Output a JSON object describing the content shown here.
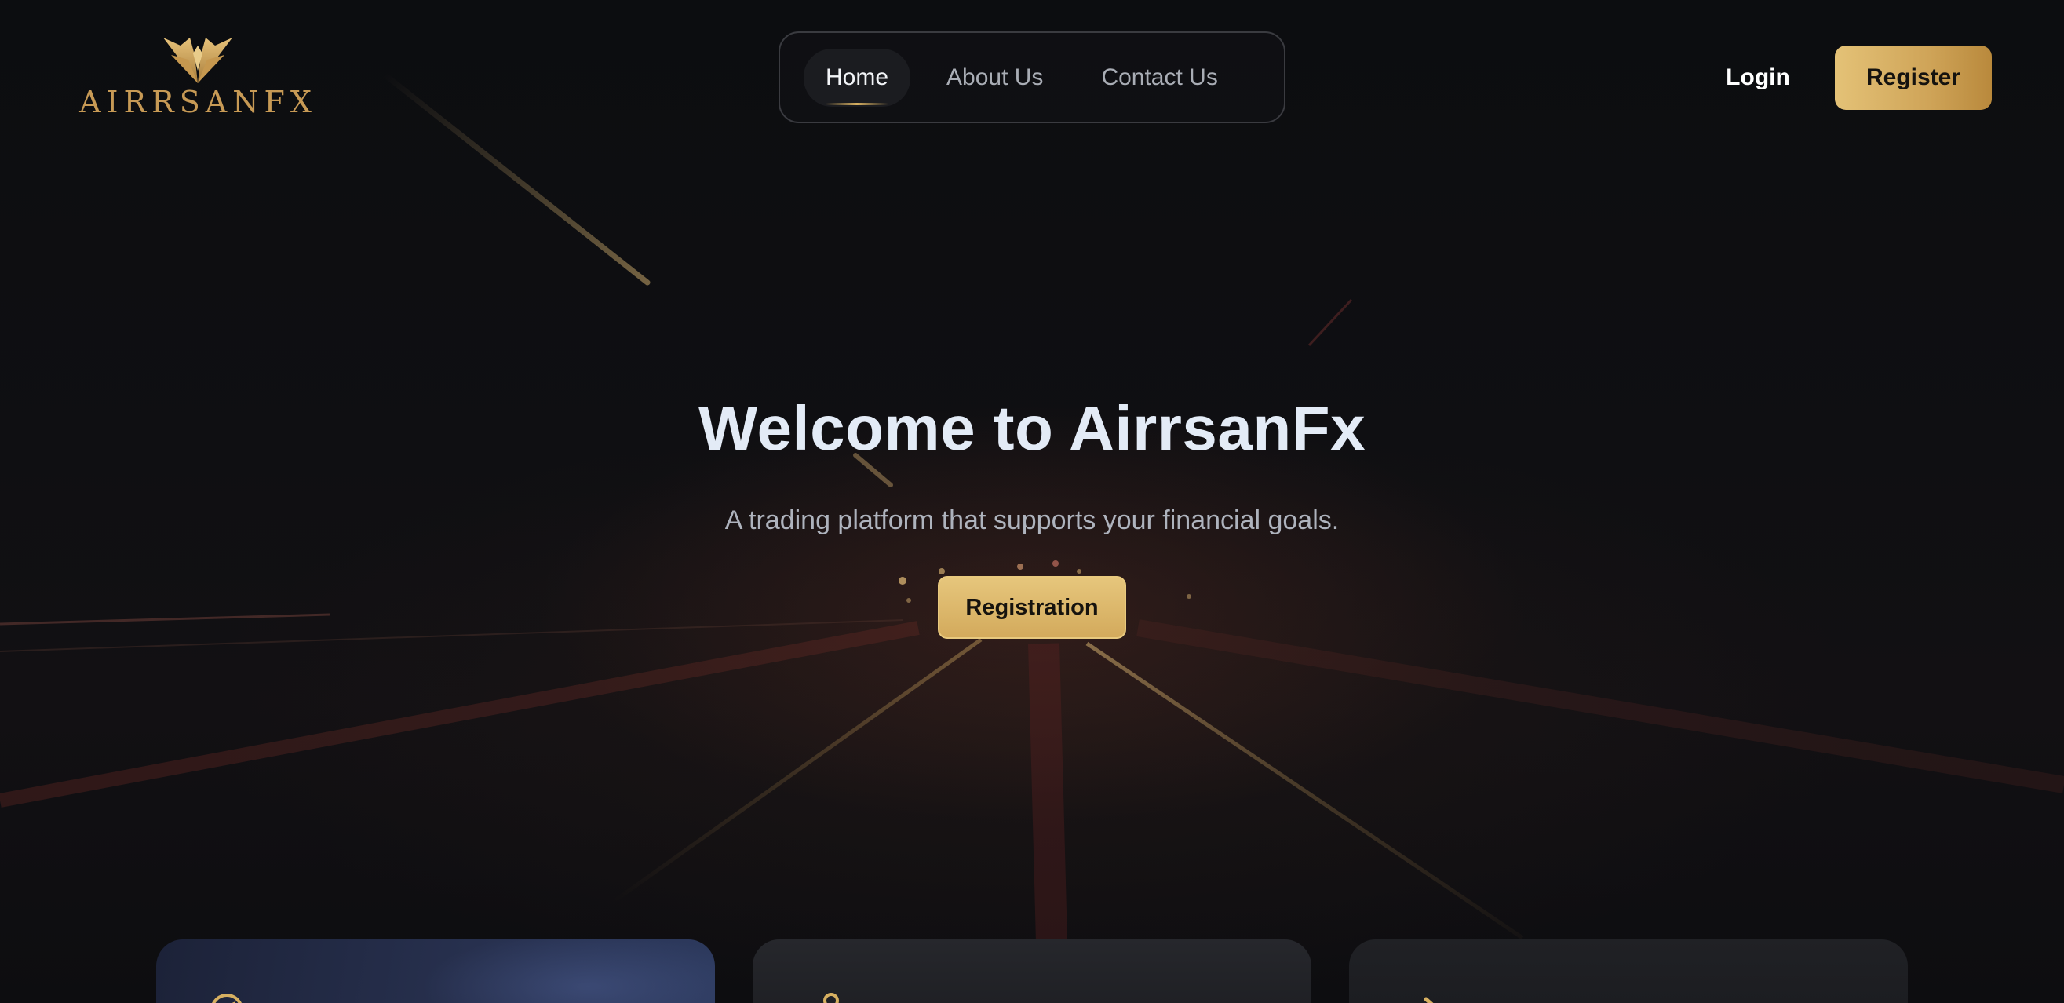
{
  "brand": {
    "logo_text": "AIRRSANFX",
    "accent_color": "#c79a55",
    "logo_icon": "winged-emblem-icon"
  },
  "nav": {
    "items": [
      {
        "label": "Home",
        "active": true
      },
      {
        "label": "About Us",
        "active": false
      },
      {
        "label": "Contact Us",
        "active": false
      }
    ]
  },
  "header": {
    "login_label": "Login",
    "register_label": "Register"
  },
  "hero": {
    "title": "Welcome to AirrsanFx",
    "subtitle": "A trading platform that supports your financial goals.",
    "cta_label": "Registration"
  },
  "cards": [
    {
      "icon": "compass-icon"
    },
    {
      "icon": "person-icon"
    },
    {
      "icon": "arrow-icon"
    }
  ],
  "colors": {
    "background": "#0d0e10",
    "gold_start": "#e4c277",
    "gold_end": "#b9893c",
    "title": "#e3ebf6"
  }
}
